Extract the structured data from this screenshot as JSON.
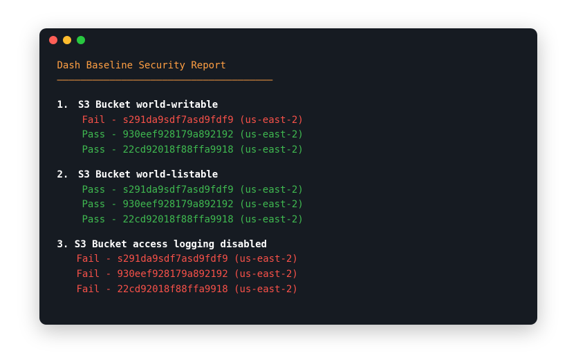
{
  "report": {
    "title": "Dash Baseline Security Report",
    "divider": "–––––––––––––––––––––––––––––––––––––",
    "sections": [
      {
        "num": "1.",
        "title": "S3 Bucket world-writable",
        "results": [
          {
            "status": "Fail",
            "text": "Fail - s291da9sdf7asd9fdf9 (us-east-2)"
          },
          {
            "status": "Pass",
            "text": "Pass - 930eef928179a892192 (us-east-2)"
          },
          {
            "status": "Pass",
            "text": "Pass - 22cd92018f88ffa9918 (us-east-2)"
          }
        ]
      },
      {
        "num": "2.",
        "title": "S3 Bucket world-listable",
        "results": [
          {
            "status": "Pass",
            "text": "Pass - s291da9sdf7asd9fdf9 (us-east-2)"
          },
          {
            "status": "Pass",
            "text": "Pass - 930eef928179a892192 (us-east-2)"
          },
          {
            "status": "Pass",
            "text": "Pass - 22cd92018f88ffa9918 (us-east-2)"
          }
        ]
      },
      {
        "num": "3.",
        "title": "S3 Bucket access logging disabled",
        "results": [
          {
            "status": "Fail",
            "text": "Fail - s291da9sdf7asd9fdf9 (us-east-2)"
          },
          {
            "status": "Fail",
            "text": "Fail - 930eef928179a892192 (us-east-2)"
          },
          {
            "status": "Fail",
            "text": "Fail - 22cd92018f88ffa9918 (us-east-2)"
          }
        ]
      }
    ]
  }
}
